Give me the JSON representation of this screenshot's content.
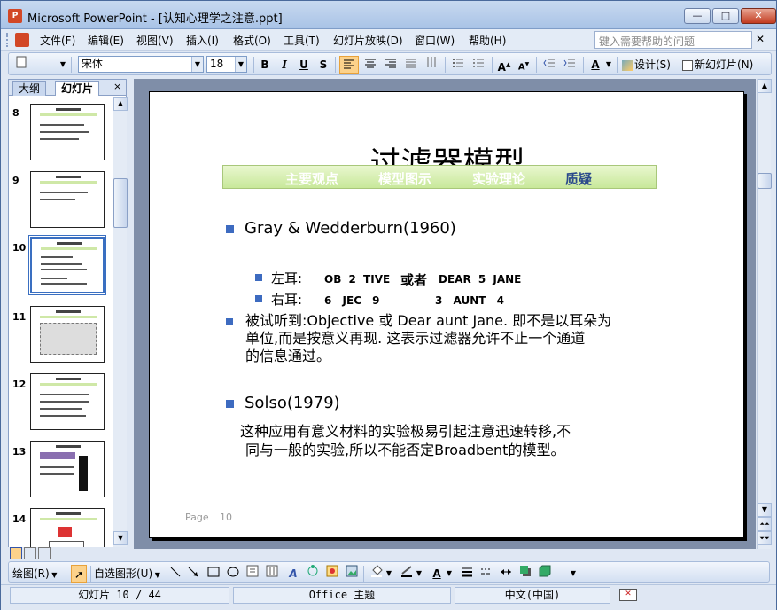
{
  "window": {
    "title": "Microsoft PowerPoint - [认知心理学之注意.ppt]",
    "app_icon": "P",
    "minimize": "—",
    "maximize": "□",
    "close": "✕"
  },
  "menu": {
    "items": [
      "文件(F)",
      "编辑(E)",
      "视图(V)",
      "插入(I)",
      "格式(O)",
      "工具(T)",
      "幻灯片放映(D)",
      "窗口(W)",
      "帮助(H)"
    ],
    "help_placeholder": "键入需要帮助的问题",
    "help_close": "✕"
  },
  "toolbar": {
    "font": "宋体",
    "size": "18",
    "bold": "B",
    "italic": "I",
    "underline": "U",
    "shadow": "S",
    "design_label": "设计(S)",
    "new_slide_label": "新幻灯片(N)"
  },
  "left_pane": {
    "tabs": [
      "大纲",
      "幻灯片"
    ],
    "close": "×",
    "thumbnails": [
      {
        "num": "8"
      },
      {
        "num": "9"
      },
      {
        "num": "10"
      },
      {
        "num": "11"
      },
      {
        "num": "12"
      },
      {
        "num": "13"
      },
      {
        "num": "14"
      }
    ],
    "selected": "10"
  },
  "slide": {
    "title": "过滤器模型",
    "nav": [
      "主要观点",
      "模型图示",
      "实验理论",
      "质疑"
    ],
    "nav_current": "质疑",
    "heading1": "Gray & Wedderburn(1960)",
    "left_ear_label": "左耳:",
    "left_ear_a": "OB 2 TIVE",
    "left_ear_or": "或者",
    "left_ear_b": "DEAR 5 JANE",
    "right_ear_label": "右耳:",
    "right_ear_a": "6 JEC 9",
    "right_ear_b": "3 AUNT 4",
    "para1_line1": "被试听到:Objective 或 Dear aunt Jane. 即不是以耳朵为",
    "para1_line2": "单位,而是按意义再现. 这表示过滤器允许不止一个通道",
    "para1_line3": "的信息通过。",
    "heading2": "Solso(1979)",
    "para2_line1": "这种应用有意义材料的实验极易引起注意迅速转移,不",
    "para2_line2": "同与一般的实验,所以不能否定Broadbent的模型。",
    "footer_label": "Page",
    "footer_num": "10"
  },
  "drawbar": {
    "draw_label": "绘图(R)",
    "autoshape_label": "自选图形(U)"
  },
  "status": {
    "slide_info": "幻灯片 10 / 44",
    "theme": "Office 主题",
    "language": "中文(中国)"
  },
  "colors": {
    "accent_bullet": "#3d6bc0",
    "nav_green": "#c8e89a",
    "selection": "#3a6fc1"
  }
}
